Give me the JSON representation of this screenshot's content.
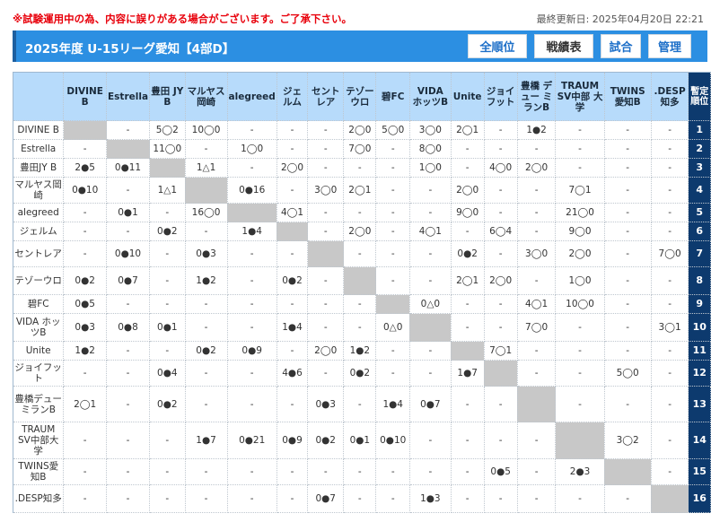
{
  "notice": "※試験運用中の為、内容に誤りがある場合がございます。ご了承下さい。",
  "updated": "最終更新日: 2025年04月20日 22:21",
  "title": "2025年度 U-15リーグ愛知【4部D】",
  "nav": {
    "standings": "全順位",
    "results": "戦績表",
    "matches": "試合",
    "admin": "管理"
  },
  "rank_header": "暫定順位",
  "teams": [
    "DIVINE B",
    "Estrella",
    "豊田JY B",
    "マルヤス岡崎",
    "alegreed",
    "ジェルム",
    "セントレア",
    "テゾーウロ",
    "碧FC",
    "VIDA ホッツB",
    "Unite",
    "ジョイフット",
    "豊橋デューミランB",
    "TRAUM SV中部大学",
    "TWINS愛知B",
    ".DESP知多"
  ],
  "col_headers": [
    "DIVINE B",
    "Estrella",
    "豊田 JY B",
    "マルヤス岡崎",
    "alegreed",
    "ジェルム",
    "セントレア",
    "テゾーウロ",
    "碧FC",
    "VIDA ホッツB",
    "Unite",
    "ジョイフット",
    "豊橋 デュー ミランB",
    "TRAUM SV中部 大学",
    "TWINS 愛知B",
    ".DESP 知多"
  ],
  "results": [
    [
      "",
      "-",
      "5◯2",
      "10◯0",
      "-",
      "-",
      "-",
      "2◯0",
      "5◯0",
      "3◯0",
      "2◯1",
      "-",
      "1●2",
      "-",
      "-",
      "-"
    ],
    [
      "-",
      "",
      "11◯0",
      "-",
      "1◯0",
      "-",
      "-",
      "7◯0",
      "-",
      "8◯0",
      "-",
      "-",
      "-",
      "-",
      "-",
      "-"
    ],
    [
      "2●5",
      "0●11",
      "",
      "1△1",
      "-",
      "2◯0",
      "-",
      "-",
      "-",
      "1◯0",
      "-",
      "4◯0",
      "2◯0",
      "-",
      "-",
      "-"
    ],
    [
      "0●10",
      "-",
      "1△1",
      "",
      "0●16",
      "-",
      "3◯0",
      "2◯1",
      "-",
      "-",
      "2◯0",
      "-",
      "-",
      "7◯1",
      "-",
      "-"
    ],
    [
      "-",
      "0●1",
      "-",
      "16◯0",
      "",
      "4◯1",
      "-",
      "-",
      "-",
      "-",
      "9◯0",
      "-",
      "-",
      "21◯0",
      "-",
      "-"
    ],
    [
      "-",
      "-",
      "0●2",
      "-",
      "1●4",
      "",
      "-",
      "2◯0",
      "-",
      "4◯1",
      "-",
      "6◯4",
      "-",
      "9◯0",
      "-",
      "-"
    ],
    [
      "-",
      "0●10",
      "-",
      "0●3",
      "-",
      "-",
      "",
      "-",
      "-",
      "-",
      "0●2",
      "-",
      "3◯0",
      "2◯0",
      "-",
      "7◯0"
    ],
    [
      "0●2",
      "0●7",
      "-",
      "1●2",
      "-",
      "0●2",
      "-",
      "",
      "-",
      "-",
      "2◯1",
      "2◯0",
      "-",
      "1◯0",
      "-",
      "-"
    ],
    [
      "0●5",
      "-",
      "-",
      "-",
      "-",
      "-",
      "-",
      "-",
      "",
      "0△0",
      "-",
      "-",
      "4◯1",
      "10◯0",
      "-",
      "-"
    ],
    [
      "0●3",
      "0●8",
      "0●1",
      "-",
      "-",
      "1●4",
      "-",
      "-",
      "0△0",
      "",
      "-",
      "-",
      "7◯0",
      "-",
      "-",
      "3◯1"
    ],
    [
      "1●2",
      "-",
      "-",
      "0●2",
      "0●9",
      "-",
      "2◯0",
      "1●2",
      "-",
      "-",
      "",
      "7◯1",
      "-",
      "-",
      "-",
      "-"
    ],
    [
      "-",
      "-",
      "0●4",
      "-",
      "-",
      "4●6",
      "-",
      "0●2",
      "-",
      "-",
      "1●7",
      "",
      "-",
      "-",
      "5◯0",
      "-"
    ],
    [
      "2◯1",
      "-",
      "0●2",
      "-",
      "-",
      "-",
      "0●3",
      "-",
      "1●4",
      "0●7",
      "-",
      "-",
      "",
      "-",
      "-",
      "-"
    ],
    [
      "-",
      "-",
      "-",
      "1●7",
      "0●21",
      "0●9",
      "0●2",
      "0●1",
      "0●10",
      "-",
      "-",
      "-",
      "-",
      "",
      "3◯2",
      "-"
    ],
    [
      "-",
      "-",
      "-",
      "-",
      "-",
      "-",
      "-",
      "-",
      "-",
      "-",
      "-",
      "0●5",
      "-",
      "2●3",
      "",
      "-"
    ],
    [
      "-",
      "-",
      "-",
      "-",
      "-",
      "-",
      "0●7",
      "-",
      "-",
      "1●3",
      "-",
      "-",
      "-",
      "-",
      "-",
      ""
    ]
  ],
  "ranks": [
    "1",
    "2",
    "3",
    "4",
    "5",
    "6",
    "7",
    "8",
    "9",
    "10",
    "11",
    "12",
    "13",
    "14",
    "15",
    "16"
  ]
}
